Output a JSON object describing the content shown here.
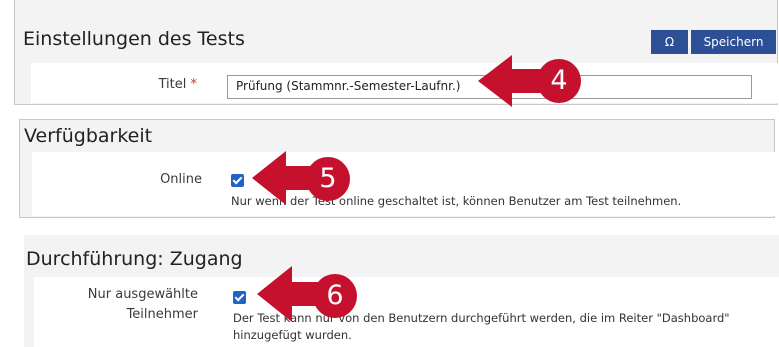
{
  "panels": {
    "settings": {
      "title": "Einstellungen des Tests",
      "special_char_button": "Ω",
      "save_button": "Speichern",
      "title_field": {
        "label": "Titel",
        "required_mark": "*",
        "value": "Prüfung (Stammnr.-Semester-Laufnr.)"
      }
    },
    "availability": {
      "title": "Verfügbarkeit",
      "online": {
        "label": "Online",
        "checked": true,
        "help": "Nur wenn der Test online geschaltet ist, können Benutzer am Test teilnehmen."
      }
    },
    "access": {
      "title": "Durchführung: Zugang",
      "selected_participants": {
        "label_line1": "Nur ausgewählte",
        "label_line2": "Teilnehmer",
        "checked": true,
        "help_line1": "Der Test kann nur von den Benutzern durchgeführt werden, die im Reiter \"Dashboard\"",
        "help_line2": "hinzugefügt wurden."
      }
    }
  },
  "callouts": [
    "4",
    "5",
    "6"
  ],
  "colors": {
    "callout": "#c5102e",
    "button": "#2c4f95",
    "checkbox": "#1f63c8",
    "panel_bg": "#f3f3f3"
  }
}
